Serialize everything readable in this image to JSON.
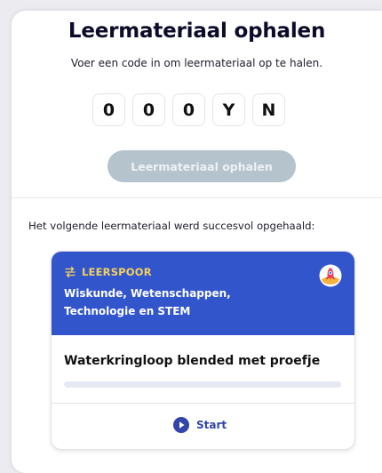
{
  "header": {
    "title": "Leermateriaal ophalen",
    "subtitle": "Voer een code in om leermateriaal op te halen."
  },
  "code": {
    "digits": [
      "0",
      "0",
      "0",
      "Y",
      "N"
    ]
  },
  "fetch_button": {
    "label": "Leermateriaal ophalen"
  },
  "result": {
    "message": "Het volgende leermateriaal werd succesvol opgehaald:"
  },
  "card": {
    "badge": "LEERSPOOR",
    "subject": "Wiskunde, Wetenschappen, Technologie en STEM",
    "title": "Waterkringloop blended met proefje",
    "progress": 0,
    "start_label": "Start",
    "icons": {
      "badge": "learning-path-icon",
      "mascot": "rocket-avatar-icon",
      "start": "play-icon"
    }
  },
  "colors": {
    "accent": "#3355cc",
    "badge": "#f2d15c",
    "disabled_button": "#b5c3cc",
    "start": "#3344aa"
  }
}
